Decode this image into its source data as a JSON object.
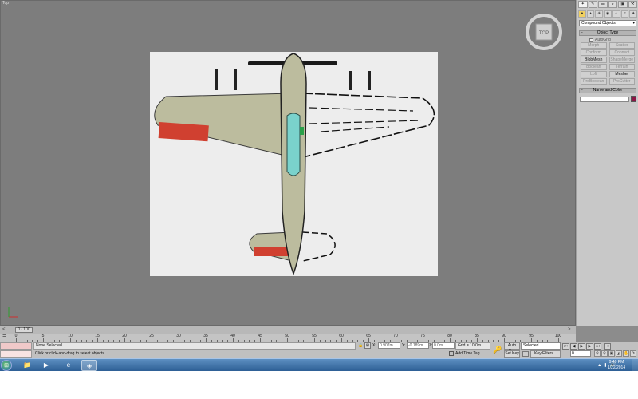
{
  "viewport": {
    "label": "Top",
    "viewcube_label": "TOP"
  },
  "command_panel": {
    "tabs": [
      "✦",
      "✎",
      "☰",
      "◒",
      "▣",
      "⚒"
    ],
    "category_icons": [
      "●",
      "▲",
      "☀",
      "◉",
      "⌂",
      "≈",
      "✦"
    ],
    "category_dropdown": "Compound Objects",
    "object_type_header": "Object Type",
    "autogrid_label": "AutoGrid",
    "object_buttons": [
      {
        "label": "Morph",
        "enabled": false
      },
      {
        "label": "Scatter",
        "enabled": false
      },
      {
        "label": "Conform",
        "enabled": false
      },
      {
        "label": "Connect",
        "enabled": false
      },
      {
        "label": "BlobMesh",
        "enabled": true
      },
      {
        "label": "ShapeMerge",
        "enabled": false
      },
      {
        "label": "Boolean",
        "enabled": false
      },
      {
        "label": "Terrain",
        "enabled": false
      },
      {
        "label": "Loft",
        "enabled": false
      },
      {
        "label": "Mesher",
        "enabled": true
      },
      {
        "label": "ProBoolean",
        "enabled": false
      },
      {
        "label": "ProCutter",
        "enabled": false
      }
    ],
    "name_color_header": "Name and Color",
    "object_color": "#8c1646"
  },
  "timeline": {
    "frame_display": "0 / 100",
    "ruler_labels": [
      "0",
      "5",
      "10",
      "15",
      "20",
      "25",
      "30",
      "35",
      "40",
      "45",
      "50",
      "55",
      "60",
      "65",
      "70",
      "75",
      "80",
      "85",
      "90",
      "95",
      "100"
    ]
  },
  "status": {
    "selection": "None Selected",
    "prompt": "Click or click-and-drag to select objects",
    "x_label": "X:",
    "y_label": "Y:",
    "z_label": "Z:",
    "x_value": "0.907m",
    "y_value": "-0.189m",
    "z_value": "0.0m",
    "grid": "Grid = 10.0m",
    "add_time_tag": "Add Time Tag"
  },
  "animation": {
    "auto_key": "Auto Key",
    "set_key": "Set Key",
    "selected_dropdown": "Selected",
    "key_filters": "Key Filters...",
    "current_frame": "0"
  },
  "taskbar": {
    "time": "9:40 PM",
    "date": "1/22/2014"
  }
}
